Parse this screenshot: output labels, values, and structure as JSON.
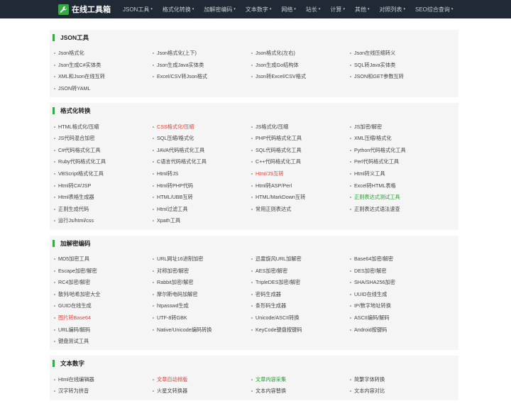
{
  "brand": {
    "title": "在线工具箱",
    "logo_icon": "wrench-icon"
  },
  "nav": [
    {
      "label": "JSON工具",
      "caret": "▾"
    },
    {
      "label": "格式化转换",
      "caret": "▾"
    },
    {
      "label": "加解密编码",
      "caret": "▾"
    },
    {
      "label": "文本数字",
      "caret": "▾"
    },
    {
      "label": "网络",
      "caret": "▾"
    },
    {
      "label": "站长",
      "caret": "▾"
    },
    {
      "label": "计算",
      "caret": "▾"
    },
    {
      "label": "其他",
      "caret": "▾"
    },
    {
      "label": "对照列表",
      "caret": "▾"
    },
    {
      "label": "SEO综合查询",
      "caret": "▾"
    }
  ],
  "colors": {
    "accent": "#37a947",
    "nav_bg": "#1f2a36",
    "highlight_red": "#e0443b",
    "highlight_green": "#2a9d35"
  },
  "sections": [
    {
      "title": "JSON工具",
      "items": [
        {
          "label": "Json格式化"
        },
        {
          "label": "Json格式化(上下)"
        },
        {
          "label": "Json格式化(左右)"
        },
        {
          "label": "Json在线压缩转义"
        },
        {
          "label": "Json生成C#实体类"
        },
        {
          "label": "Json生成Java实体类"
        },
        {
          "label": "Json生成Go结构体"
        },
        {
          "label": "SQL转Java实体类"
        },
        {
          "label": "XML和Json在线互转"
        },
        {
          "label": "Excel/CSV转Json格式"
        },
        {
          "label": "Json转Excel/CSV格式"
        },
        {
          "label": "JSON和GET参数互转"
        },
        {
          "label": "JSON转YAML"
        }
      ]
    },
    {
      "title": "格式化转换",
      "items": [
        {
          "label": "HTML格式化/压缩"
        },
        {
          "label": "CSS格式化/压缩",
          "style": "red"
        },
        {
          "label": "JS格式化/压缩"
        },
        {
          "label": "JS加密/解密"
        },
        {
          "label": "JS代码混合加密"
        },
        {
          "label": "SQL压缩/格式化"
        },
        {
          "label": "PHP代码格式化工具"
        },
        {
          "label": "XML压缩/格式化"
        },
        {
          "label": "C#代码格式化工具"
        },
        {
          "label": "JAVA代码格式化工具"
        },
        {
          "label": "SQL代码格式化工具"
        },
        {
          "label": "Python代码格式化工具"
        },
        {
          "label": "Ruby代码格式化工具"
        },
        {
          "label": "C语言代码格式化工具"
        },
        {
          "label": "C++代码格式化工具"
        },
        {
          "label": "Perl代码格式化工具"
        },
        {
          "label": "VBScript格式化工具"
        },
        {
          "label": "Html转JS"
        },
        {
          "label": "Html/JS互转",
          "style": "red"
        },
        {
          "label": "Html转义工具"
        },
        {
          "label": "Html转C#/JSP"
        },
        {
          "label": "Html转PHP代码"
        },
        {
          "label": "Html转ASP/Perl"
        },
        {
          "label": "Excel转HTML表格"
        },
        {
          "label": "Html表格生成器"
        },
        {
          "label": "HTML/UBB互转"
        },
        {
          "label": "HTML/MarkDown互转"
        },
        {
          "label": "正则表达式测试工具",
          "style": "green"
        },
        {
          "label": "正则生成代码"
        },
        {
          "label": "Html过滤工具"
        },
        {
          "label": "常用正则表达式"
        },
        {
          "label": "正则表达式语法速查"
        },
        {
          "label": "运行Js/html/css"
        },
        {
          "label": "Xpath工具"
        }
      ]
    },
    {
      "title": "加解密编码",
      "items": [
        {
          "label": "MD5加密工具"
        },
        {
          "label": "URL网址16进制加密"
        },
        {
          "label": "迅雷旋风URL加解密"
        },
        {
          "label": "Base64加密/解密"
        },
        {
          "label": "Escape加密/解密"
        },
        {
          "label": "对称加密/解密"
        },
        {
          "label": "AES加密/解密"
        },
        {
          "label": "DES加密/解密"
        },
        {
          "label": "RC4加密/解密"
        },
        {
          "label": "Rabbit加密/解密"
        },
        {
          "label": "TripleDES加密/解密"
        },
        {
          "label": "SHA/SHA256加密"
        },
        {
          "label": "散列/哈希加密大全"
        },
        {
          "label": "摩尔斯电码加解密"
        },
        {
          "label": "密码生成器"
        },
        {
          "label": "UUID在线生成"
        },
        {
          "label": "GUID在线生成"
        },
        {
          "label": "htpasswd生成"
        },
        {
          "label": "条形码生成器"
        },
        {
          "label": "IP/数字地址转换"
        },
        {
          "label": "图片转Base64",
          "style": "red"
        },
        {
          "label": "UTF-8转GBK"
        },
        {
          "label": "Unicode/ASCII转换"
        },
        {
          "label": "ASCII编码/解码"
        },
        {
          "label": "URL编码/解码"
        },
        {
          "label": "Native/Unicode编码转换"
        },
        {
          "label": "KeyCode键盘按键码"
        },
        {
          "label": "Android按键码"
        },
        {
          "label": "键盘测试工具"
        }
      ]
    },
    {
      "title": "文本数字",
      "items": [
        {
          "label": "Html在线编辑器"
        },
        {
          "label": "文章自动排版",
          "style": "red"
        },
        {
          "label": "文章内容采集",
          "style": "green"
        },
        {
          "label": "简繁字体转换"
        },
        {
          "label": "汉字转为拼音"
        },
        {
          "label": "火星文转换器"
        },
        {
          "label": "文本内容替换"
        },
        {
          "label": "文本内容对比"
        }
      ]
    }
  ]
}
